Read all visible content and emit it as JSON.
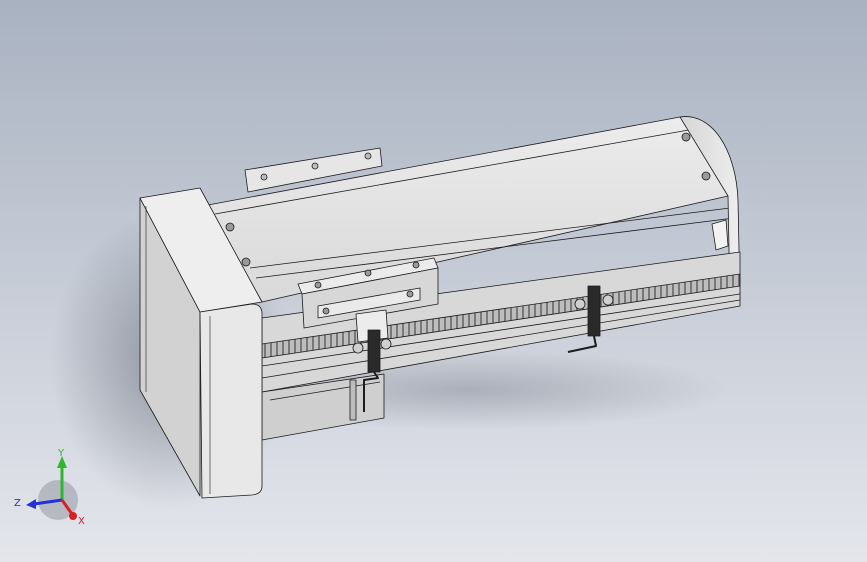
{
  "viewport": {
    "background_top": "#a9b2c1",
    "background_bottom": "#e4e6ec"
  },
  "model": {
    "part_color": "#e6e6e6",
    "shade_color": "#c9c9c9",
    "edge_color": "#1c1c1c",
    "slot_color": "#7b7b7b"
  },
  "triad": {
    "axes": {
      "y": {
        "label": "Y",
        "color": "#2fb52f"
      },
      "z": {
        "label": "Z",
        "color": "#2232d8"
      },
      "x": {
        "label": "X",
        "color": "#d82020"
      }
    }
  }
}
